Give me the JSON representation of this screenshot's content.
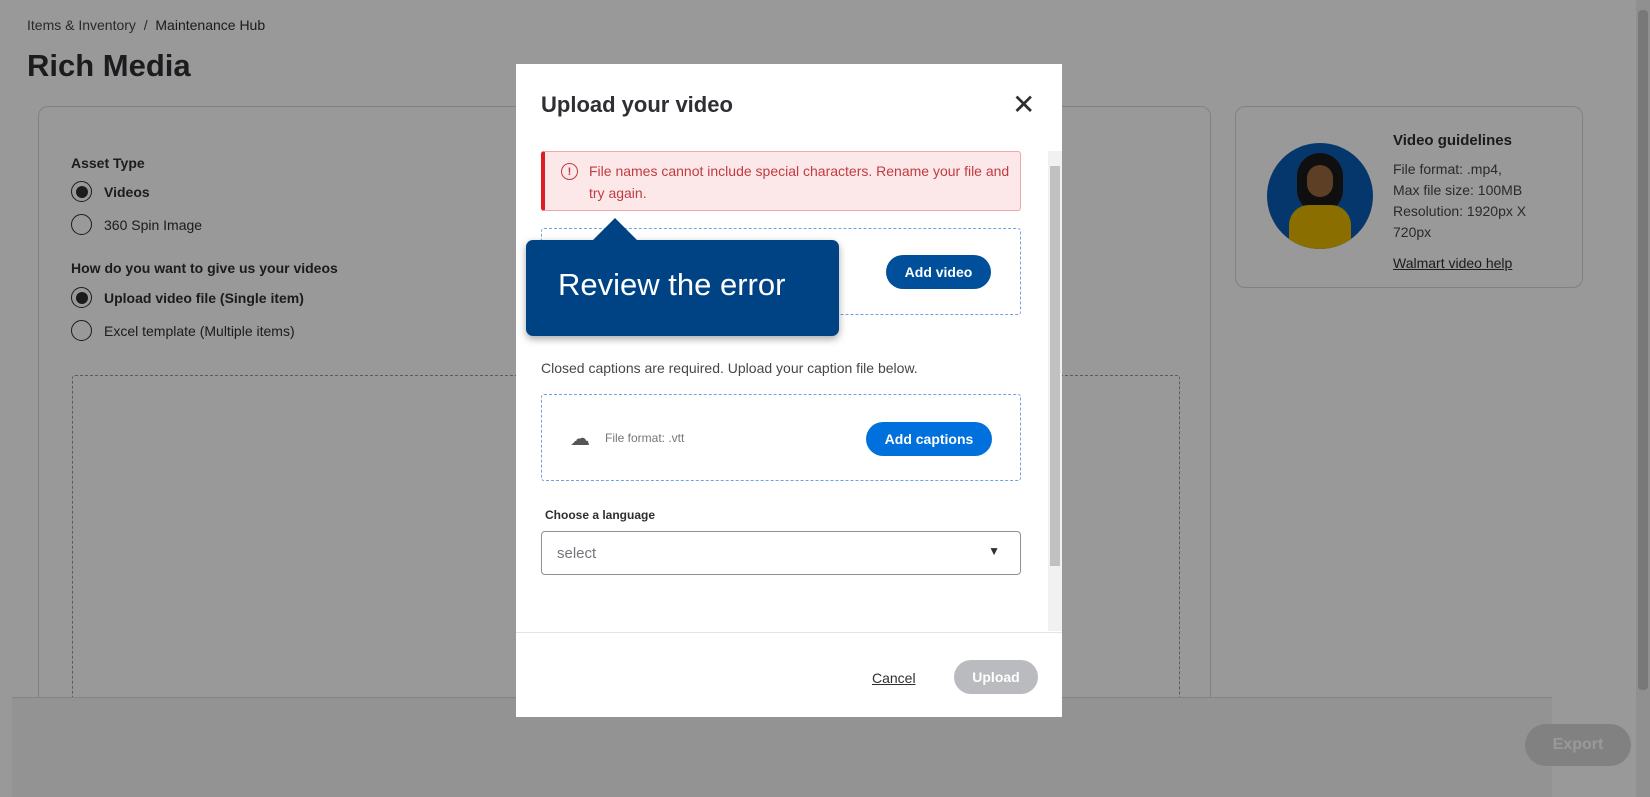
{
  "breadcrumb": {
    "parent": "Items & Inventory",
    "current": "Maintenance Hub"
  },
  "page_title": "Rich Media",
  "asset_type": {
    "label": "Asset Type",
    "options": [
      {
        "label": "Videos",
        "selected": true
      },
      {
        "label": "360 Spin Image",
        "selected": false
      }
    ]
  },
  "method": {
    "label": "How do you want to give us your videos",
    "options": [
      {
        "label": "Upload video file (Single item)",
        "selected": true
      },
      {
        "label": "Excel template (Multiple items)",
        "selected": false
      }
    ]
  },
  "guidelines": {
    "title": "Video guidelines",
    "lines": [
      "File format: .mp4,",
      "Max file size: 100MB",
      "Resolution: 1920px X",
      "720px"
    ],
    "link": "Walmart video help"
  },
  "export_label": "Export",
  "modal": {
    "title": "Upload your video",
    "error": "File names cannot include special characters. Rename your file and try again.",
    "add_video": "Add video",
    "captions_note": "Closed captions are required. Upload your caption file below.",
    "caption_format": "File format: .vtt",
    "add_captions": "Add captions",
    "language_label": "Choose a language",
    "language_placeholder": "select",
    "cancel": "Cancel",
    "upload": "Upload"
  },
  "tooltip": "Review the error",
  "colors": {
    "primary": "#0071dc",
    "navy": "#004384",
    "error": "#de1c24"
  }
}
